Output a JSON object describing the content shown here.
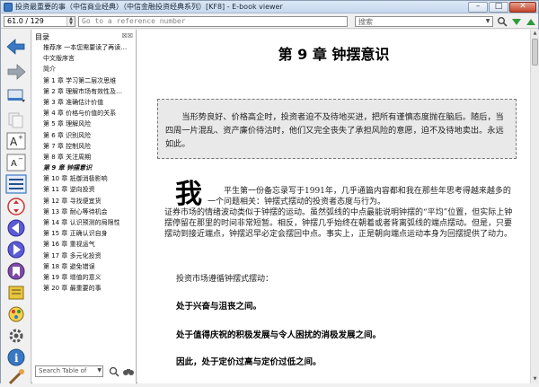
{
  "window": {
    "title": "投资最重要的事（中信商业经典）（中信金融投资经典系列）[KF8] - E-book viewer",
    "minimize": "–",
    "maximize": "□",
    "close": "✕"
  },
  "toolbar": {
    "position_value": "61.0 / 129",
    "reference_placeholder": "Go to a reference number",
    "search_placeholder": "搜索",
    "search_dropdown": "▼"
  },
  "toc": {
    "header_label": "目录",
    "header_buttons": "☒☒",
    "items": [
      "推荐序 一本您需要读了再读…",
      "中文版序言",
      "简介",
      "第 1 章 学习第二层次思维",
      "第 2 章 理解市场有效性及…",
      "第 3 章 准确估计价值",
      "第 4 章 价格与价值的关系",
      "第 5 章 理解风险",
      "第 6 章 识别风险",
      "第 7 章 控制风险",
      "第 8 章 关注周期",
      "第 9 章 钟摆意识",
      "第 10 章 抵御消极影响",
      "第 11 章 逆向投资",
      "第 12 章 寻找便宜货",
      "第 13 章 耐心等待机会",
      "第 14 章 认识预测的局限性",
      "第 15 章 正确认识自身",
      "第 16 章 重视运气",
      "第 17 章 多元化投资",
      "第 18 章 避免错误",
      "第 19 章 增值的意义",
      "第 20 章 最重要的事"
    ],
    "active_index": 11,
    "search_placeholder": "Search Table of ",
    "search_dropdown": "▼"
  },
  "content": {
    "chapter_title": "第 9 章 钟摆意识",
    "quote": "当形势良好、价格高企时，投资者迫不及待地买进，把所有谨慎态度抛在脑后。随后，当四周一片混乱、资产廉价待沽时，他们又完全丧失了承担风险的意愿，迫不及待地卖出。永远如此。",
    "dropcap": "我",
    "para1_first": "平生第一份备忘录写于1991年，几乎通篇内容都和我在那些年思考得越来越多的一个问题相关：钟摆式摆动的投资者态度与行为。",
    "para1_rest": "证券市场的情绪波动类似于钟摆的运动。虽然弧线的中点最能说明钟摆的“平均”位置，但实际上钟摆停留在那里的时间非常短暂。相反，钟摆几乎始终在朝着或者背离弧线的端点摆动。但是，只要摆动到接近端点，钟摆迟早必定会摆回中点。事实上，正是朝向端点运动本身为回摆提供了动力。",
    "intro_line": "投资市场遵循钟摆式摆动：",
    "bold_lines": [
      "处于兴奋与沮丧之间。",
      "处于值得庆祝的积极发展与令人困扰的消极发展之间。",
      "因此，处于定价过高与定价过低之间。"
    ]
  },
  "colors": {
    "accent_blue": "#3a78c3",
    "nav_green": "#2e9a3a"
  }
}
